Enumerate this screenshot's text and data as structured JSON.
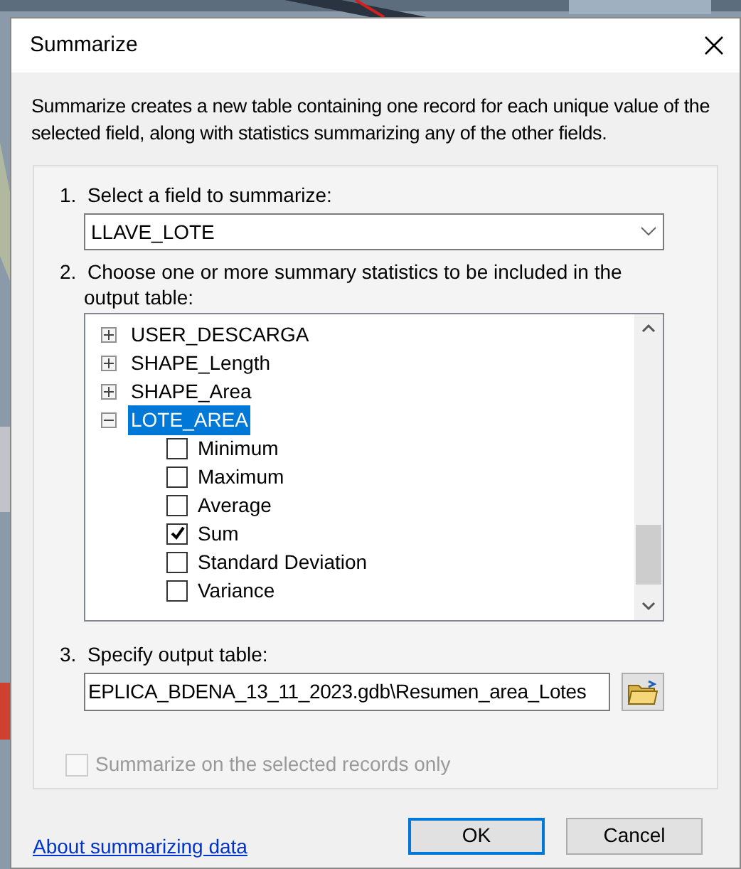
{
  "window": {
    "title": "Summarize"
  },
  "description": "Summarize creates a new table containing one record for each unique value of the selected field, along with statistics summarizing any of the other fields.",
  "step1": {
    "label": "1.  Select a field to summarize:",
    "value": "LLAVE_LOTE"
  },
  "step2": {
    "label": "2.  Choose one or more summary statistics to be included in the output table:",
    "fields": [
      {
        "label": "USER_DESCARGA",
        "expanded": false,
        "selected": false
      },
      {
        "label": "SHAPE_Length",
        "expanded": false,
        "selected": false
      },
      {
        "label": "SHAPE_Area",
        "expanded": false,
        "selected": false
      },
      {
        "label": "LOTE_AREA",
        "expanded": true,
        "selected": true,
        "children": [
          {
            "label": "Minimum",
            "checked": false
          },
          {
            "label": "Maximum",
            "checked": false
          },
          {
            "label": "Average",
            "checked": false
          },
          {
            "label": "Sum",
            "checked": true
          },
          {
            "label": "Standard Deviation",
            "checked": false
          },
          {
            "label": "Variance",
            "checked": false
          }
        ]
      }
    ]
  },
  "step3": {
    "label": "3.  Specify output table:",
    "value": "EPLICA_BDENA_13_11_2023.gdb\\Resumen_area_Lotes"
  },
  "selected_only": {
    "label": "Summarize on the selected records only",
    "checked": false,
    "disabled": true
  },
  "help_link": "About summarizing data",
  "buttons": [
    {
      "label": "OK",
      "default": true
    },
    {
      "label": "Cancel",
      "default": false
    }
  ]
}
